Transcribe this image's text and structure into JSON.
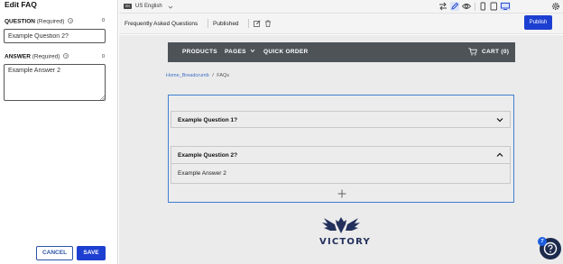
{
  "editor": {
    "title": "Edit FAQ",
    "question_label": "QUESTION",
    "question_required": "(Required)",
    "question_counter": "0",
    "question_value": "Example Question 2?",
    "answer_label": "ANSWER",
    "answer_required": "(Required)",
    "answer_counter": "0",
    "answer_value": "Example Answer 2",
    "help_glyph": "?",
    "cancel_label": "CANCEL",
    "save_label": "SAVE"
  },
  "toolbar": {
    "language_icon": "EN",
    "language": "US English",
    "icons": [
      "swap-icon",
      "pencil-icon",
      "eye-icon",
      "phone-icon",
      "tablet-icon",
      "desktop-icon",
      "gear-icon"
    ]
  },
  "pagebar": {
    "page_name": "Frequently Asked Questions",
    "status": "Published",
    "publish_label": "Publish"
  },
  "storefront": {
    "nav": {
      "products": "PRODUCTS",
      "pages": "PAGES",
      "quick_order": "QUICK ORDER",
      "cart": "CART (0)"
    },
    "breadcrumb": {
      "home": "Home_Breadcrumb",
      "separator": "/",
      "current": "FAQs"
    },
    "faqs": [
      {
        "question": "Example Question 1?",
        "expanded": false
      },
      {
        "question": "Example Question 2?",
        "answer": "Example Answer 2",
        "expanded": true
      }
    ],
    "logo_text": "VICTORY"
  },
  "help": {
    "badge": "7"
  },
  "colors": {
    "primary": "#1d3fd1",
    "nav_bg": "#4e5358",
    "selection": "#3d7fd1",
    "logo": "#23305c"
  }
}
